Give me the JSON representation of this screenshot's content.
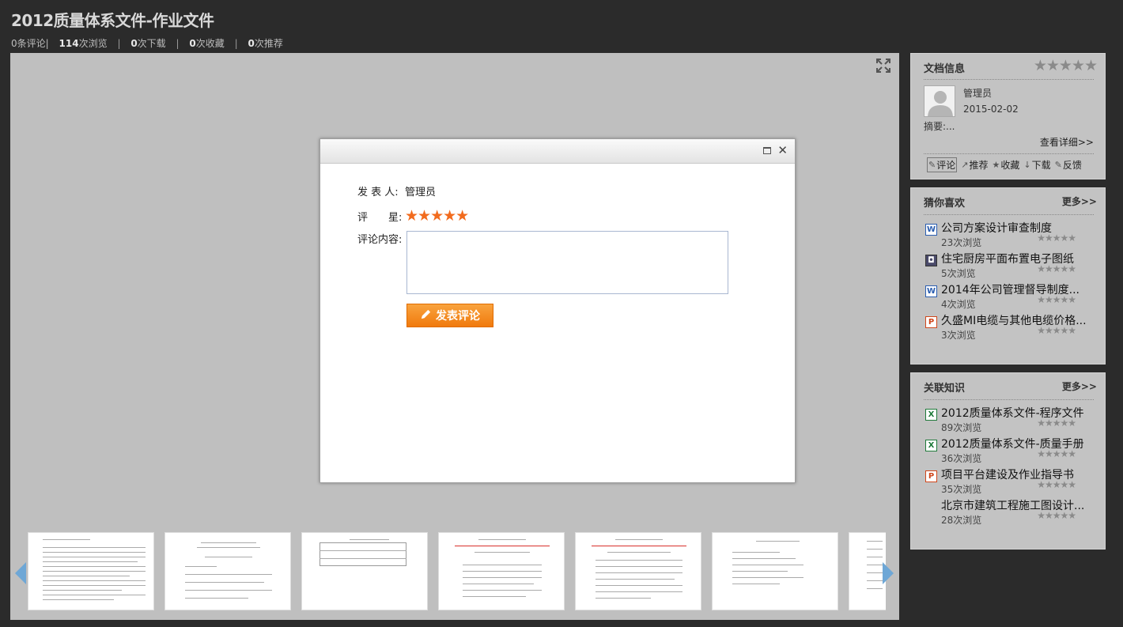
{
  "header": {
    "title": "2012质量体系文件-作业文件",
    "stats": {
      "comments_count": "0",
      "comments_label": "条评论",
      "views_count": "114",
      "views_label": "次浏览",
      "downloads_count": "0",
      "downloads_label": "次下载",
      "favorites_count": "0",
      "favorites_label": "次收藏",
      "recommends_count": "0",
      "recommends_label": "次推荐",
      "separator": "|"
    }
  },
  "viewer": {
    "fullscreen_icon": "expand-icon",
    "thumbnails_count": 7
  },
  "comment_dialog": {
    "author_label": "发 表 人:",
    "author_value": "管理员",
    "rating_label": "评　　星:",
    "rating_value": 5,
    "rating_stars": "★★★★★",
    "content_label": "评论内容:",
    "content_value": "",
    "submit_label": "发表评论",
    "close_symbol": "✕"
  },
  "doc_info": {
    "title": "文档信息",
    "rating_stars": "★★★★★",
    "author": "管理员",
    "date": "2015-02-02",
    "summary": "摘要:...",
    "detail_link": "查看详细>>",
    "actions": [
      {
        "label": "评论",
        "icon": "comment-icon",
        "glyph": "✎"
      },
      {
        "label": "推荐",
        "icon": "share-icon",
        "glyph": "↗"
      },
      {
        "label": "收藏",
        "icon": "star-icon",
        "glyph": "★"
      },
      {
        "label": "下载",
        "icon": "download-icon",
        "glyph": "↓"
      },
      {
        "label": "反馈",
        "icon": "feedback-icon",
        "glyph": "✎"
      }
    ]
  },
  "guess_like": {
    "title": "猜你喜欢",
    "more": "更多>>",
    "items": [
      {
        "title": "公司方案设计审查制度",
        "views": "23次浏览",
        "type": "word",
        "glyph": "W",
        "stars": "★★★★★"
      },
      {
        "title": "住宅厨房平面布置电子图纸",
        "views": "5次浏览",
        "type": "cad",
        "glyph": "◘",
        "stars": "★★★★★"
      },
      {
        "title": "2014年公司管理督导制度...",
        "views": "4次浏览",
        "type": "word",
        "glyph": "W",
        "stars": "★★★★★"
      },
      {
        "title": "久盛MI电缆与其他电缆价格...",
        "views": "3次浏览",
        "type": "ppt",
        "glyph": "P",
        "stars": "★★★★★"
      }
    ]
  },
  "related": {
    "title": "关联知识",
    "more": "更多>>",
    "items": [
      {
        "title": "2012质量体系文件-程序文件",
        "views": "89次浏览",
        "type": "excel",
        "glyph": "X",
        "stars": "★★★★★"
      },
      {
        "title": "2012质量体系文件-质量手册",
        "views": "36次浏览",
        "type": "excel",
        "glyph": "X",
        "stars": "★★★★★"
      },
      {
        "title": "项目平台建设及作业指导书",
        "views": "35次浏览",
        "type": "ppt",
        "glyph": "P",
        "stars": "★★★★★"
      },
      {
        "title": "北京市建筑工程施工图设计...",
        "views": "28次浏览",
        "type": "none",
        "glyph": "",
        "stars": "★★★★★"
      }
    ]
  }
}
